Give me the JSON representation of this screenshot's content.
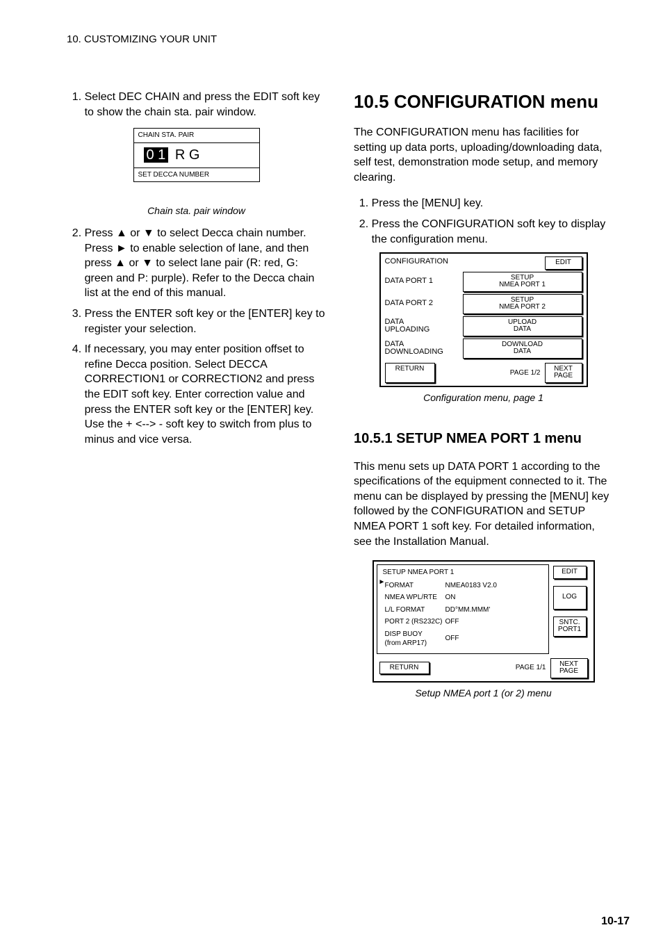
{
  "header": "10. CUSTOMIZING YOUR UNIT",
  "page_number": "10-17",
  "left": {
    "step1": "Select DEC CHAIN and press the EDIT soft key to show the chain sta. pair window.",
    "chain_window": {
      "title": "CHAIN STA. PAIR",
      "num": "0 1",
      "pair": "R G",
      "hint": "SET DECCA NUMBER"
    },
    "fig1_caption": "Chain sta. pair window",
    "step2": "Press ▲ or ▼ to select Decca chain number. Press ► to enable selection of lane, and then press ▲ or ▼ to select lane pair (R: red, G: green and P: purple). Refer to the Decca chain list at the end of this manual.",
    "step3": "Press the ENTER soft key or the [ENTER] key to register your selection.",
    "step4": "If necessary, you may enter position offset to refine Decca position. Select DECCA CORRECTION1 or CORRECTION2 and press the EDIT soft key. Enter correction value and press the ENTER soft key or the [ENTER] key. Use the + <--> - soft key to switch from plus to minus and vice versa."
  },
  "right": {
    "sec105_num": "10.5",
    "sec105_title": "CONFIGURATION menu",
    "sec105_intro": "The CONFIGURATION menu has facilities for setting up data ports, uploading/downloading data, self test, demonstration mode setup, and memory clearing.",
    "sec105_step1": "Press the [MENU] key.",
    "sec105_step2": "Press the CONFIGURATION soft key to display the configuration menu.",
    "config_menu": {
      "title": "CONFIGURATION",
      "edit": "EDIT",
      "rows": [
        {
          "label": "DATA PORT 1",
          "btn": "SETUP\nNMEA PORT 1"
        },
        {
          "label": "DATA PORT 2",
          "btn": "SETUP\nNMEA PORT 2"
        },
        {
          "label": "DATA\nUPLOADING",
          "btn": "UPLOAD\nDATA"
        },
        {
          "label": "DATA\nDOWNLOADING",
          "btn": "DOWNLOAD\nDATA"
        }
      ],
      "return": "RETURN",
      "page_label": "PAGE 1/2",
      "next": "NEXT\nPAGE"
    },
    "fig2_caption": "Configuration menu, page 1",
    "sec1051_num": "10.5.1",
    "sec1051_title": "SETUP NMEA PORT 1 menu",
    "sec1051_body": "This menu sets up DATA PORT 1 according to the specifications of the equipment connected to it. The menu can be displayed by pressing the [MENU] key followed by the CONFIGURATION and SETUP NMEA PORT 1 soft key. For detailed information, see the Installation Manual.",
    "nmea_menu": {
      "title": "SETUP NMEA PORT 1",
      "edit": "EDIT",
      "log": "LOG",
      "sntc": "SNTC.\nPORT1",
      "rows": [
        [
          "FORMAT",
          "NMEA0183 V2.0"
        ],
        [
          "NMEA WPL/RTE",
          "ON"
        ],
        [
          "L/L FORMAT",
          "DD°MM.MMM'"
        ],
        [
          "PORT 2 (RS232C)",
          "OFF"
        ],
        [
          "DISP BUOY\n(from ARP17)",
          "OFF"
        ]
      ],
      "return": "RETURN",
      "page_label": "PAGE 1/1",
      "next": "NEXT\nPAGE"
    },
    "fig3_caption": "Setup NMEA port 1 (or 2) menu"
  }
}
